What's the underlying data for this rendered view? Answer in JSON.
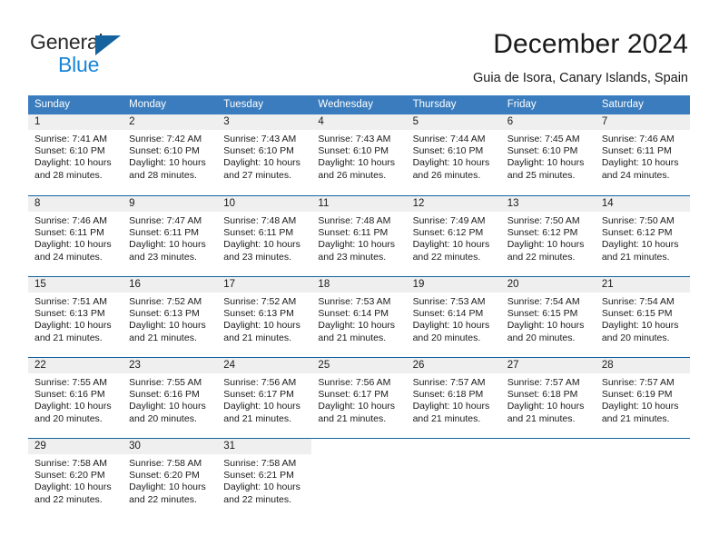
{
  "brand": {
    "name_part1": "General",
    "name_part2": "Blue",
    "triangle_icon": "triangle-logo-icon",
    "colors": {
      "general_text": "#2b2b2b",
      "blue_text": "#1a86d8",
      "triangle": "#14639e"
    }
  },
  "header": {
    "title": "December 2024",
    "subtitle": "Guia de Isora, Canary Islands, Spain"
  },
  "calendar": {
    "accent_color": "#3a7cbd",
    "row_border_color": "#14639e",
    "day_band_color": "#efefef",
    "weekdays": [
      "Sunday",
      "Monday",
      "Tuesday",
      "Wednesday",
      "Thursday",
      "Friday",
      "Saturday"
    ],
    "weeks": [
      [
        {
          "day": "1",
          "sunrise": "Sunrise: 7:41 AM",
          "sunset": "Sunset: 6:10 PM",
          "daylight1": "Daylight: 10 hours",
          "daylight2": "and 28 minutes."
        },
        {
          "day": "2",
          "sunrise": "Sunrise: 7:42 AM",
          "sunset": "Sunset: 6:10 PM",
          "daylight1": "Daylight: 10 hours",
          "daylight2": "and 28 minutes."
        },
        {
          "day": "3",
          "sunrise": "Sunrise: 7:43 AM",
          "sunset": "Sunset: 6:10 PM",
          "daylight1": "Daylight: 10 hours",
          "daylight2": "and 27 minutes."
        },
        {
          "day": "4",
          "sunrise": "Sunrise: 7:43 AM",
          "sunset": "Sunset: 6:10 PM",
          "daylight1": "Daylight: 10 hours",
          "daylight2": "and 26 minutes."
        },
        {
          "day": "5",
          "sunrise": "Sunrise: 7:44 AM",
          "sunset": "Sunset: 6:10 PM",
          "daylight1": "Daylight: 10 hours",
          "daylight2": "and 26 minutes."
        },
        {
          "day": "6",
          "sunrise": "Sunrise: 7:45 AM",
          "sunset": "Sunset: 6:10 PM",
          "daylight1": "Daylight: 10 hours",
          "daylight2": "and 25 minutes."
        },
        {
          "day": "7",
          "sunrise": "Sunrise: 7:46 AM",
          "sunset": "Sunset: 6:11 PM",
          "daylight1": "Daylight: 10 hours",
          "daylight2": "and 24 minutes."
        }
      ],
      [
        {
          "day": "8",
          "sunrise": "Sunrise: 7:46 AM",
          "sunset": "Sunset: 6:11 PM",
          "daylight1": "Daylight: 10 hours",
          "daylight2": "and 24 minutes."
        },
        {
          "day": "9",
          "sunrise": "Sunrise: 7:47 AM",
          "sunset": "Sunset: 6:11 PM",
          "daylight1": "Daylight: 10 hours",
          "daylight2": "and 23 minutes."
        },
        {
          "day": "10",
          "sunrise": "Sunrise: 7:48 AM",
          "sunset": "Sunset: 6:11 PM",
          "daylight1": "Daylight: 10 hours",
          "daylight2": "and 23 minutes."
        },
        {
          "day": "11",
          "sunrise": "Sunrise: 7:48 AM",
          "sunset": "Sunset: 6:11 PM",
          "daylight1": "Daylight: 10 hours",
          "daylight2": "and 23 minutes."
        },
        {
          "day": "12",
          "sunrise": "Sunrise: 7:49 AM",
          "sunset": "Sunset: 6:12 PM",
          "daylight1": "Daylight: 10 hours",
          "daylight2": "and 22 minutes."
        },
        {
          "day": "13",
          "sunrise": "Sunrise: 7:50 AM",
          "sunset": "Sunset: 6:12 PM",
          "daylight1": "Daylight: 10 hours",
          "daylight2": "and 22 minutes."
        },
        {
          "day": "14",
          "sunrise": "Sunrise: 7:50 AM",
          "sunset": "Sunset: 6:12 PM",
          "daylight1": "Daylight: 10 hours",
          "daylight2": "and 21 minutes."
        }
      ],
      [
        {
          "day": "15",
          "sunrise": "Sunrise: 7:51 AM",
          "sunset": "Sunset: 6:13 PM",
          "daylight1": "Daylight: 10 hours",
          "daylight2": "and 21 minutes."
        },
        {
          "day": "16",
          "sunrise": "Sunrise: 7:52 AM",
          "sunset": "Sunset: 6:13 PM",
          "daylight1": "Daylight: 10 hours",
          "daylight2": "and 21 minutes."
        },
        {
          "day": "17",
          "sunrise": "Sunrise: 7:52 AM",
          "sunset": "Sunset: 6:13 PM",
          "daylight1": "Daylight: 10 hours",
          "daylight2": "and 21 minutes."
        },
        {
          "day": "18",
          "sunrise": "Sunrise: 7:53 AM",
          "sunset": "Sunset: 6:14 PM",
          "daylight1": "Daylight: 10 hours",
          "daylight2": "and 21 minutes."
        },
        {
          "day": "19",
          "sunrise": "Sunrise: 7:53 AM",
          "sunset": "Sunset: 6:14 PM",
          "daylight1": "Daylight: 10 hours",
          "daylight2": "and 20 minutes."
        },
        {
          "day": "20",
          "sunrise": "Sunrise: 7:54 AM",
          "sunset": "Sunset: 6:15 PM",
          "daylight1": "Daylight: 10 hours",
          "daylight2": "and 20 minutes."
        },
        {
          "day": "21",
          "sunrise": "Sunrise: 7:54 AM",
          "sunset": "Sunset: 6:15 PM",
          "daylight1": "Daylight: 10 hours",
          "daylight2": "and 20 minutes."
        }
      ],
      [
        {
          "day": "22",
          "sunrise": "Sunrise: 7:55 AM",
          "sunset": "Sunset: 6:16 PM",
          "daylight1": "Daylight: 10 hours",
          "daylight2": "and 20 minutes."
        },
        {
          "day": "23",
          "sunrise": "Sunrise: 7:55 AM",
          "sunset": "Sunset: 6:16 PM",
          "daylight1": "Daylight: 10 hours",
          "daylight2": "and 20 minutes."
        },
        {
          "day": "24",
          "sunrise": "Sunrise: 7:56 AM",
          "sunset": "Sunset: 6:17 PM",
          "daylight1": "Daylight: 10 hours",
          "daylight2": "and 21 minutes."
        },
        {
          "day": "25",
          "sunrise": "Sunrise: 7:56 AM",
          "sunset": "Sunset: 6:17 PM",
          "daylight1": "Daylight: 10 hours",
          "daylight2": "and 21 minutes."
        },
        {
          "day": "26",
          "sunrise": "Sunrise: 7:57 AM",
          "sunset": "Sunset: 6:18 PM",
          "daylight1": "Daylight: 10 hours",
          "daylight2": "and 21 minutes."
        },
        {
          "day": "27",
          "sunrise": "Sunrise: 7:57 AM",
          "sunset": "Sunset: 6:18 PM",
          "daylight1": "Daylight: 10 hours",
          "daylight2": "and 21 minutes."
        },
        {
          "day": "28",
          "sunrise": "Sunrise: 7:57 AM",
          "sunset": "Sunset: 6:19 PM",
          "daylight1": "Daylight: 10 hours",
          "daylight2": "and 21 minutes."
        }
      ],
      [
        {
          "day": "29",
          "sunrise": "Sunrise: 7:58 AM",
          "sunset": "Sunset: 6:20 PM",
          "daylight1": "Daylight: 10 hours",
          "daylight2": "and 22 minutes."
        },
        {
          "day": "30",
          "sunrise": "Sunrise: 7:58 AM",
          "sunset": "Sunset: 6:20 PM",
          "daylight1": "Daylight: 10 hours",
          "daylight2": "and 22 minutes."
        },
        {
          "day": "31",
          "sunrise": "Sunrise: 7:58 AM",
          "sunset": "Sunset: 6:21 PM",
          "daylight1": "Daylight: 10 hours",
          "daylight2": "and 22 minutes."
        },
        {
          "day": "",
          "sunrise": "",
          "sunset": "",
          "daylight1": "",
          "daylight2": ""
        },
        {
          "day": "",
          "sunrise": "",
          "sunset": "",
          "daylight1": "",
          "daylight2": ""
        },
        {
          "day": "",
          "sunrise": "",
          "sunset": "",
          "daylight1": "",
          "daylight2": ""
        },
        {
          "day": "",
          "sunrise": "",
          "sunset": "",
          "daylight1": "",
          "daylight2": ""
        }
      ]
    ]
  }
}
